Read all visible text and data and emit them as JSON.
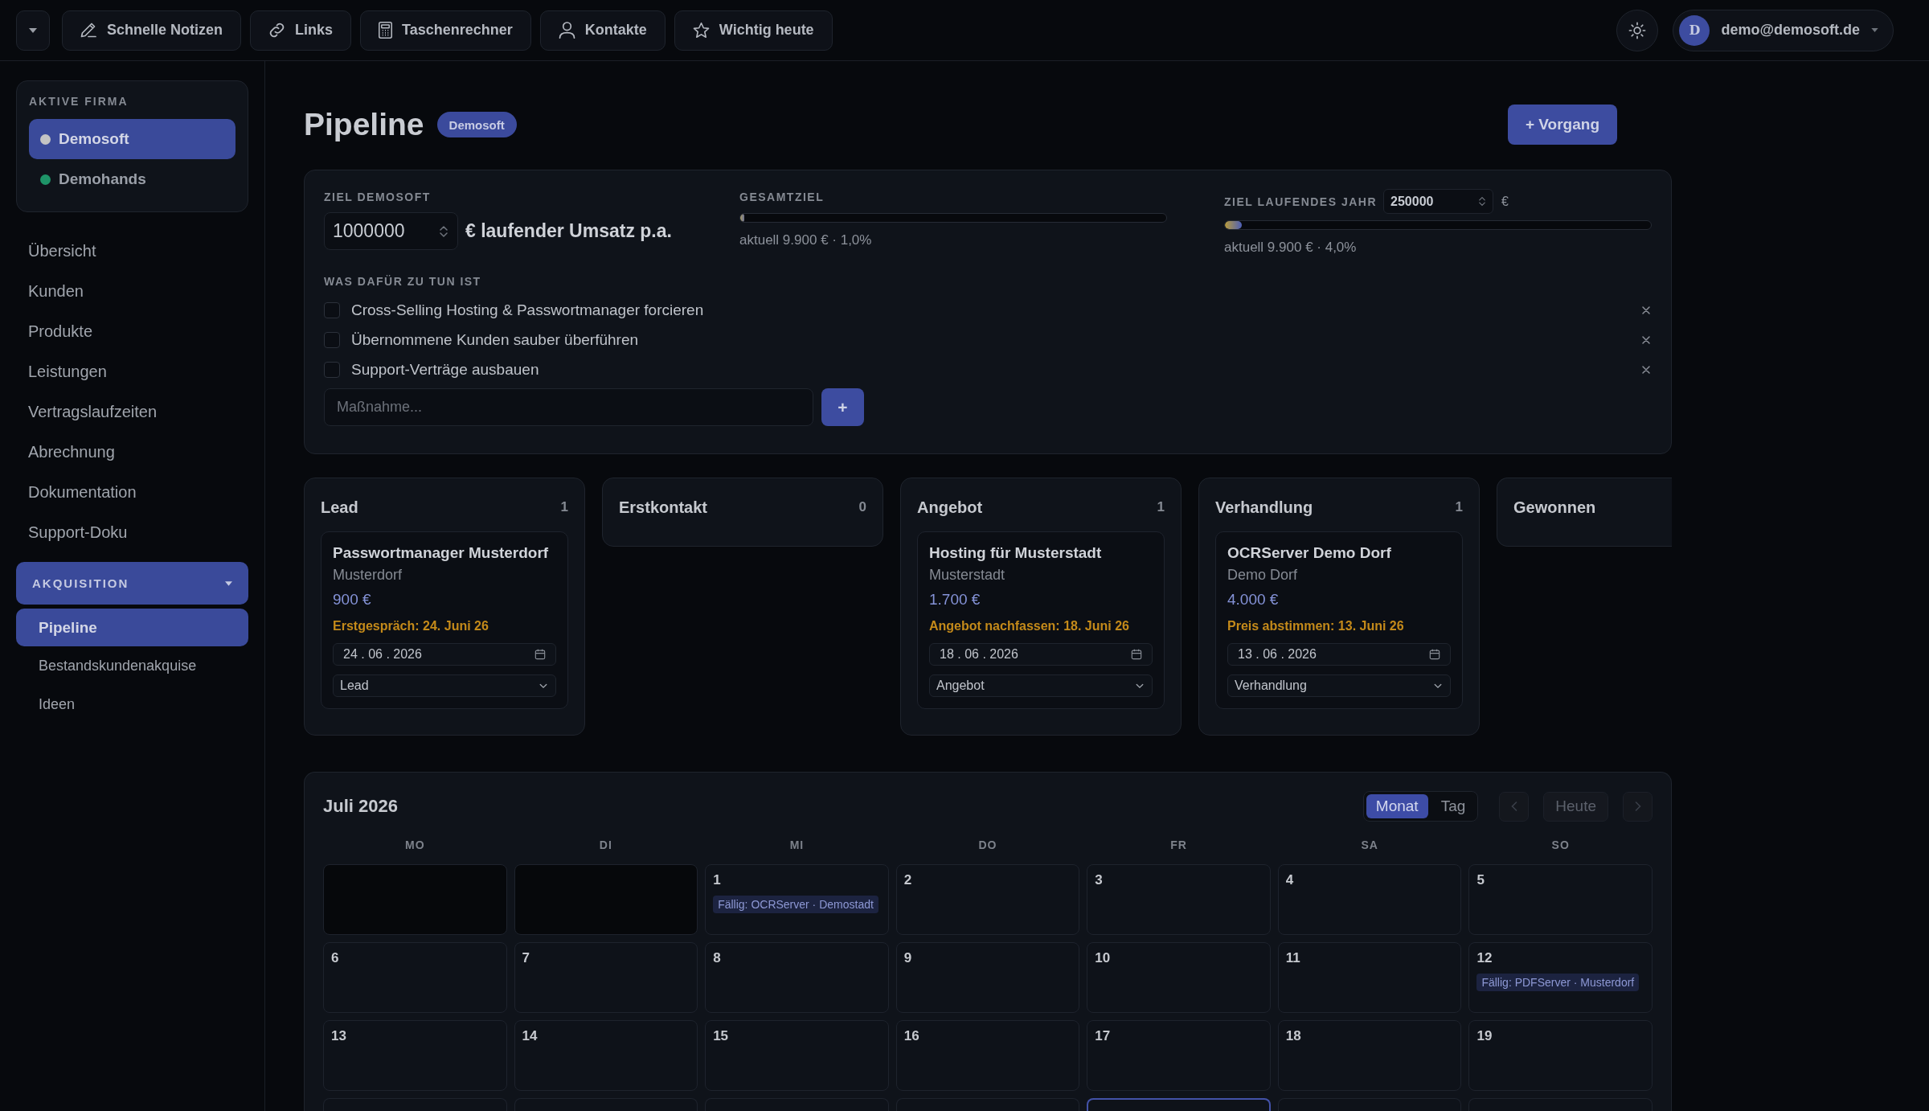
{
  "topbar": {
    "tools": [
      {
        "label": "Schnelle Notizen"
      },
      {
        "label": "Links"
      },
      {
        "label": "Taschenrechner"
      },
      {
        "label": "Kontakte"
      },
      {
        "label": "Wichtig heute"
      }
    ],
    "user": {
      "initial": "D",
      "email": "demo@demosoft.de"
    }
  },
  "sidebar": {
    "company_panel": {
      "label": "AKTIVE FIRMA",
      "companies": [
        {
          "name": "Demosoft",
          "selected": true,
          "color": "#c4c4c4"
        },
        {
          "name": "Demohands",
          "selected": false,
          "color": "#1e9468"
        }
      ]
    },
    "nav": [
      {
        "label": "Übersicht",
        "selected": false
      },
      {
        "label": "Kunden",
        "selected": false
      },
      {
        "label": "Produkte",
        "selected": false
      },
      {
        "label": "Leistungen",
        "selected": false
      },
      {
        "label": "Vertragslaufzeiten",
        "selected": false
      },
      {
        "label": "Abrechnung",
        "selected": false
      },
      {
        "label": "Dokumentation",
        "selected": false
      },
      {
        "label": "Support-Doku",
        "selected": false
      }
    ],
    "group": {
      "label": "AKQUISITION",
      "expanded": true,
      "items": [
        {
          "label": "Pipeline",
          "selected": true
        },
        {
          "label": "Bestandskundenakquise",
          "selected": false
        },
        {
          "label": "Ideen",
          "selected": false
        }
      ]
    }
  },
  "header": {
    "title": "Pipeline",
    "badge": "Demosoft",
    "new_button": "+ Vorgang"
  },
  "goals": {
    "company_goal": {
      "label": "ZIEL DEMOSOFT",
      "value": "1000000",
      "suffix": "€ laufender Umsatz p.a."
    },
    "total": {
      "label": "GESAMTZIEL",
      "level": 0.01,
      "reading": "aktuell 9.900 € · 1,0%"
    },
    "year": {
      "label": "ZIEL LAUFENDES JAHR",
      "value": "250000",
      "unit": "€",
      "level": 0.04,
      "reading": "aktuell 9.900 € · 4,0%"
    },
    "tasks_label": "WAS DAFÜR ZU TUN IST",
    "tasks": [
      {
        "text": "Cross-Selling Hosting & Passwortmanager forcieren",
        "checked": false
      },
      {
        "text": "Übernommene Kunden sauber überführen",
        "checked": false
      },
      {
        "text": "Support-Verträge ausbauen",
        "checked": false
      }
    ],
    "new_task": {
      "placeholder": "Maßnahme..."
    },
    "add_button": "+"
  },
  "pipeline": {
    "columns": [
      {
        "title": "Lead",
        "count": "1",
        "cards": [
          {
            "title": "Passwortmanager Musterdorf",
            "customer": "Musterdorf",
            "amount": "900 €",
            "due": "Erstgespräch: 24. Juni 26",
            "date": "24 . 06 . 2026",
            "stage": "Lead"
          }
        ]
      },
      {
        "title": "Erstkontakt",
        "count": "0"
      },
      {
        "title": "Angebot",
        "count": "1",
        "cards": [
          {
            "title": "Hosting für Musterstadt",
            "customer": "Musterstadt",
            "amount": "1.700 €",
            "due": "Angebot nachfassen: 18. Juni 26",
            "date": "18 . 06 . 2026",
            "stage": "Angebot"
          }
        ]
      },
      {
        "title": "Verhandlung",
        "count": "1",
        "cards": [
          {
            "title": "OCRServer Demo Dorf",
            "customer": "Demo Dorf",
            "amount": "4.000 €",
            "due": "Preis abstimmen: 13. Juni 26",
            "date": "13 . 06 . 2026",
            "stage": "Verhandlung"
          }
        ]
      },
      {
        "title": "Gewonnen"
      }
    ]
  },
  "calendar": {
    "title": "Juli 2026",
    "views": [
      {
        "label": "Monat",
        "selected": true
      },
      {
        "label": "Tag",
        "selected": false
      }
    ],
    "today_button": "Heute",
    "weekdays": [
      "MO",
      "DI",
      "MI",
      "DO",
      "FR",
      "SA",
      "SO"
    ],
    "weeks": [
      {
        "days": [
          {
            "outside": true,
            "today": false
          },
          {
            "outside": true,
            "today": false
          },
          {
            "day": "1",
            "outside": false,
            "today": false,
            "events": [
              "Fällig: OCRServer · Demostadt"
            ]
          },
          {
            "day": "2",
            "outside": false,
            "today": false
          },
          {
            "day": "3",
            "outside": false,
            "today": false
          },
          {
            "day": "4",
            "outside": false,
            "today": false
          },
          {
            "day": "5",
            "outside": false,
            "today": false
          }
        ]
      },
      {
        "days": [
          {
            "day": "6",
            "outside": false,
            "today": false
          },
          {
            "day": "7",
            "outside": false,
            "today": false
          },
          {
            "day": "8",
            "outside": false,
            "today": false
          },
          {
            "day": "9",
            "outside": false,
            "today": false
          },
          {
            "day": "10",
            "outside": false,
            "today": false
          },
          {
            "day": "11",
            "outside": false,
            "today": false
          },
          {
            "day": "12",
            "outside": false,
            "today": false,
            "events": [
              "Fällig: PDFServer · Musterdorf"
            ]
          }
        ]
      },
      {
        "days": [
          {
            "day": "13",
            "outside": false,
            "today": false
          },
          {
            "day": "14",
            "outside": false,
            "today": false
          },
          {
            "day": "15",
            "outside": false,
            "today": false
          },
          {
            "day": "16",
            "outside": false,
            "today": false
          },
          {
            "day": "17",
            "outside": false,
            "today": false
          },
          {
            "day": "18",
            "outside": false,
            "today": false
          },
          {
            "day": "19",
            "outside": false,
            "today": false
          }
        ]
      },
      {
        "days": [
          {
            "outside": false,
            "today": false
          },
          {
            "outside": false,
            "today": false
          },
          {
            "outside": false,
            "today": false
          },
          {
            "outside": false,
            "today": false
          },
          {
            "outside": false,
            "today": true
          },
          {
            "outside": false,
            "today": false
          },
          {
            "outside": false,
            "today": false
          }
        ]
      }
    ]
  }
}
